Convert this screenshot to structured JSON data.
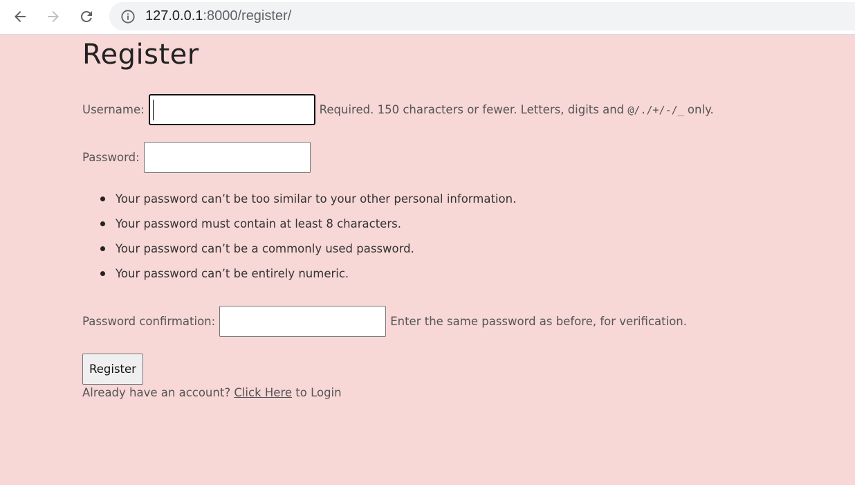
{
  "browser": {
    "url_host": "127.0.0.1",
    "url_rest": ":8000/register/"
  },
  "page": {
    "title": "Register",
    "username": {
      "label": "Username:",
      "value": "",
      "help_prefix": "Required. 150 characters or fewer. Letters, digits and ",
      "help_symbols": "@/./+/-/_",
      "help_suffix": " only."
    },
    "password": {
      "label": "Password:",
      "value": ""
    },
    "password_rules": [
      "Your password can’t be too similar to your other personal information.",
      "Your password must contain at least 8 characters.",
      "Your password can’t be a commonly used password.",
      "Your password can’t be entirely numeric."
    ],
    "password_confirmation": {
      "label": "Password confirmation:",
      "value": "",
      "help": "Enter the same password as before, for verification."
    },
    "submit_label": "Register",
    "login_prompt": {
      "before": "Already have an account? ",
      "link": "Click Here",
      "after": " to Login"
    }
  },
  "colors": {
    "background": "#f8d7d7",
    "text": "#555555"
  }
}
